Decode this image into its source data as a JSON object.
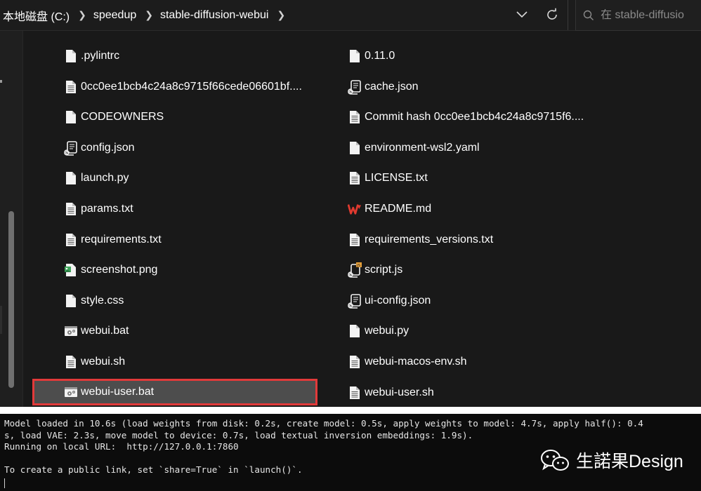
{
  "address_bar": {
    "breadcrumbs": [
      "本地磁盘 (C:)",
      "speedup",
      "stable-diffusion-webui"
    ],
    "search_placeholder": "在 stable-diffusio"
  },
  "files": {
    "left": [
      {
        "name": ".pylintrc",
        "icon": "document-icon"
      },
      {
        "name": "0cc0ee1bcb4c24a8c9715f66cede06601bf....",
        "icon": "text-file-icon"
      },
      {
        "name": "CODEOWNERS",
        "icon": "document-icon"
      },
      {
        "name": "config.json",
        "icon": "script-icon"
      },
      {
        "name": "launch.py",
        "icon": "document-icon"
      },
      {
        "name": "params.txt",
        "icon": "text-file-icon"
      },
      {
        "name": "requirements.txt",
        "icon": "text-file-icon"
      },
      {
        "name": "screenshot.png",
        "icon": "image-file-icon"
      },
      {
        "name": "style.css",
        "icon": "document-icon"
      },
      {
        "name": "webui.bat",
        "icon": "batch-file-icon"
      },
      {
        "name": "webui.sh",
        "icon": "text-file-icon"
      },
      {
        "name": "webui-user.bat",
        "icon": "batch-file-icon"
      }
    ],
    "right": [
      {
        "name": "0.11.0",
        "icon": "document-icon"
      },
      {
        "name": "cache.json",
        "icon": "script-icon"
      },
      {
        "name": "Commit hash 0cc0ee1bcb4c24a8c9715f6....",
        "icon": "text-file-icon"
      },
      {
        "name": "environment-wsl2.yaml",
        "icon": "document-icon"
      },
      {
        "name": "LICENSE.txt",
        "icon": "text-file-icon"
      },
      {
        "name": "README.md",
        "icon": "wps-icon"
      },
      {
        "name": "requirements_versions.txt",
        "icon": "text-file-icon"
      },
      {
        "name": "script.js",
        "icon": "script-js-icon"
      },
      {
        "name": "ui-config.json",
        "icon": "script-icon"
      },
      {
        "name": "webui.py",
        "icon": "document-icon"
      },
      {
        "name": "webui-macos-env.sh",
        "icon": "text-file-icon"
      },
      {
        "name": "webui-user.sh",
        "icon": "text-file-icon"
      }
    ],
    "selected": "webui-user.bat"
  },
  "terminal": {
    "lines": [
      "Model loaded in 10.6s (load weights from disk: 0.2s, create model: 0.5s, apply weights to model: 4.7s, apply half(): 0.4",
      "s, load VAE: 2.3s, move model to device: 0.7s, load textual inversion embeddings: 1.9s).",
      "Running on local URL:  http://127.0.0.1:7860",
      "",
      "To create a public link, set `share=True` in `launch()`."
    ]
  },
  "watermark": {
    "text": "生諾果Design",
    "icon": "wechat-icon"
  },
  "colors": {
    "explorer_bg": "#191919",
    "selected_bg": "#4d4d4d",
    "highlight_border": "#e23a3a",
    "terminal_bg": "#0c0c0c",
    "wps_red": "#e03a2f"
  }
}
